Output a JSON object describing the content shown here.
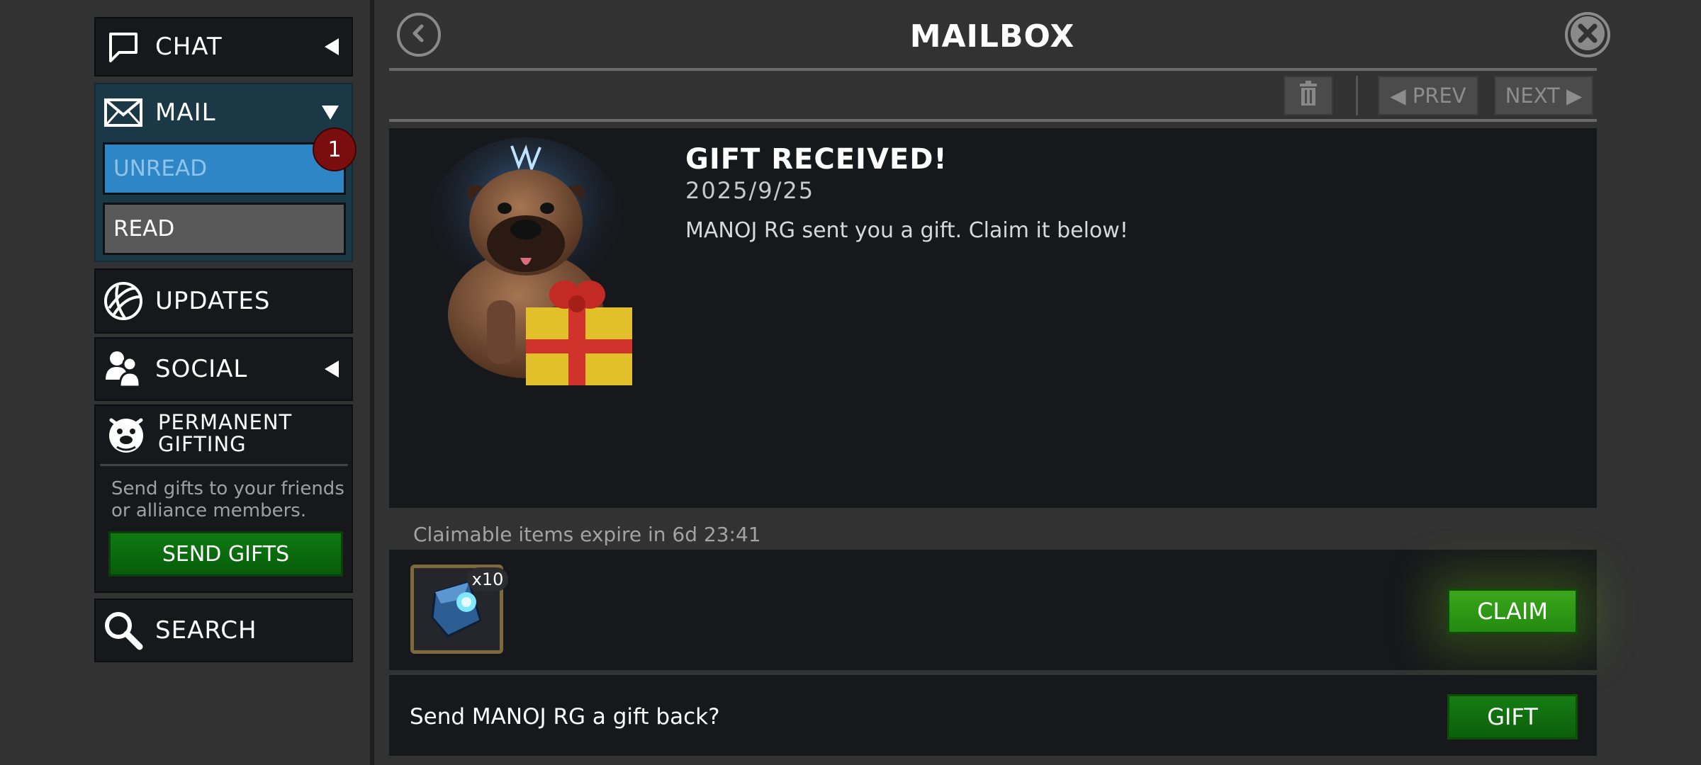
{
  "sidebar": {
    "chat": {
      "label": "CHAT",
      "icon": "chat-bubble-icon"
    },
    "mail": {
      "label": "MAIL",
      "icon": "envelope-icon",
      "unread_label": "UNREAD",
      "unread_count": "1",
      "read_label": "READ"
    },
    "updates": {
      "label": "UPDATES",
      "icon": "globe-icon"
    },
    "social": {
      "label": "SOCIAL",
      "icon": "people-icon"
    },
    "gifting": {
      "label_line1": "PERMANENT",
      "label_line2": "GIFTING",
      "icon": "bulldog-icon",
      "description_line1": "Send gifts to your friends",
      "description_line2": "or alliance members.",
      "button_label": "SEND GIFTS"
    },
    "search": {
      "label": "SEARCH",
      "icon": "magnifier-icon"
    }
  },
  "header": {
    "title": "MAILBOX"
  },
  "toolbar": {
    "prev_label": "◀ PREV",
    "next_label": "NEXT ▶"
  },
  "message": {
    "title": "GIFT RECEIVED!",
    "date": "2025/9/25",
    "body": "MANOJ RG sent you a gift. Claim it below!"
  },
  "claim": {
    "expire_text": "Claimable items expire in 6d 23:41",
    "item_quantity": "x10",
    "claim_label": "CLAIM"
  },
  "gift_back": {
    "text": "Send MANOJ RG a gift back?",
    "button_label": "GIFT"
  },
  "colors": {
    "unread_blue": "#2f86c6",
    "read_gray": "#595959",
    "badge_red": "#7a0d0d",
    "green_button": "#2e9d17"
  }
}
